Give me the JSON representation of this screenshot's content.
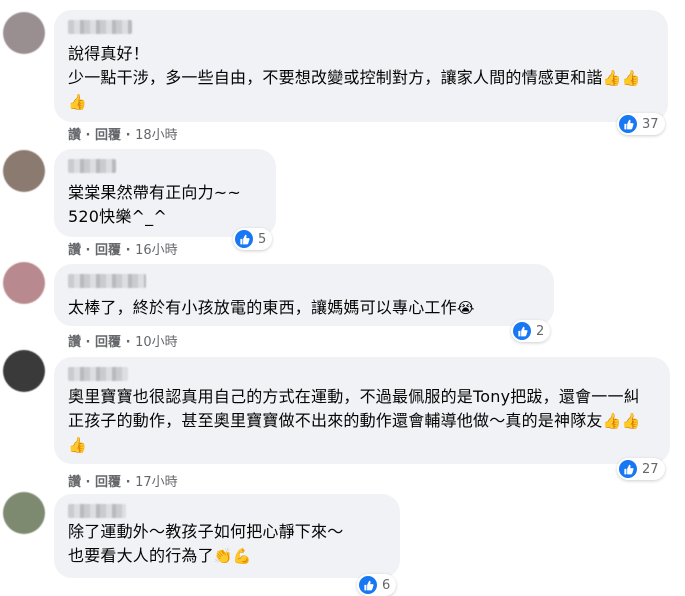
{
  "like_label": "讚",
  "reply_label": "回覆",
  "separator": "·",
  "comments": [
    {
      "text": "說得真好！\n少一點干涉，多一些自由，不要想改變或控制對方，讓家人間的情感更和諧",
      "emoji": "👍👍👍",
      "reactions": "37",
      "time": "18小時"
    },
    {
      "text": "棠棠果然帶有正向力~~\n520快樂^_^",
      "emoji": "",
      "reactions": "5",
      "time": "16小時"
    },
    {
      "text": "太棒了，終於有小孩放電的東西，讓媽媽可以專心工作",
      "emoji": "😭",
      "reactions": "2",
      "time": "10小時"
    },
    {
      "text": "奧里寶寶也很認真用自己的方式在運動，不過最佩服的是Tony把跋，還會一一糾正孩子的動作，甚至奧里寶寶做不出來的動作還會輔導他做～真的是神隊友",
      "emoji": "👍👍👍",
      "reactions": "27",
      "time": "17小時"
    },
    {
      "text": "除了運動外～教孩子如何把心靜下來～\n也要看大人的行為了",
      "emoji": "👏💪",
      "reactions": "6",
      "time": ""
    }
  ],
  "colors": {
    "bubble": "#f0f2f5",
    "like": "#1877f2",
    "meta": "#65676b"
  },
  "icons": [
    "like-icon"
  ]
}
